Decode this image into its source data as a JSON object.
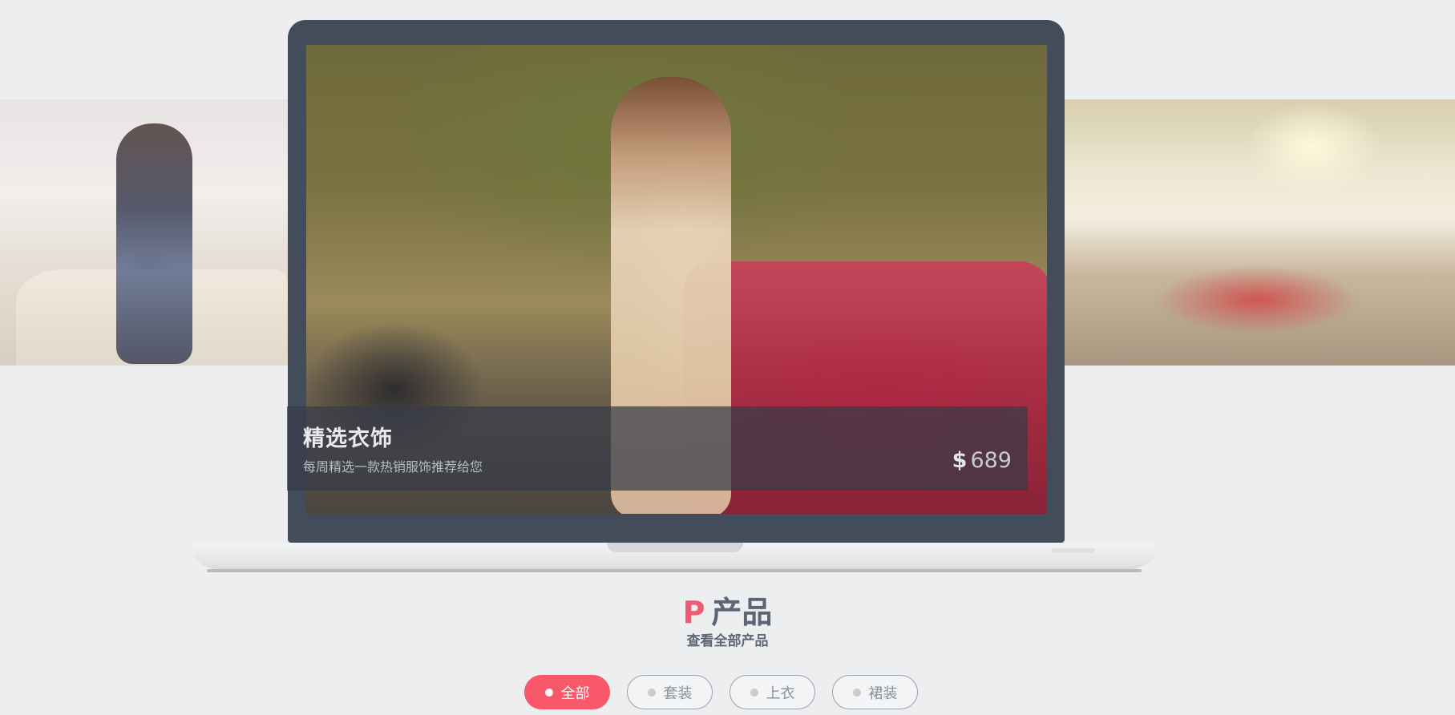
{
  "hero": {
    "title": "精选衣饰",
    "subtitle": "每周精选一款热销服饰推荐给您",
    "price_currency": "$",
    "price_value": "689"
  },
  "section": {
    "title_letter": "P",
    "title_text": "产品",
    "subtitle": "查看全部产品"
  },
  "filters": [
    {
      "label": "全部",
      "active": true
    },
    {
      "label": "套装",
      "active": false
    },
    {
      "label": "上衣",
      "active": false
    },
    {
      "label": "裙装",
      "active": false
    }
  ],
  "colors": {
    "accent": "#f7596b",
    "laptop_frame": "#434c5a",
    "background": "#edeef0",
    "heading_text": "#5b6575"
  }
}
